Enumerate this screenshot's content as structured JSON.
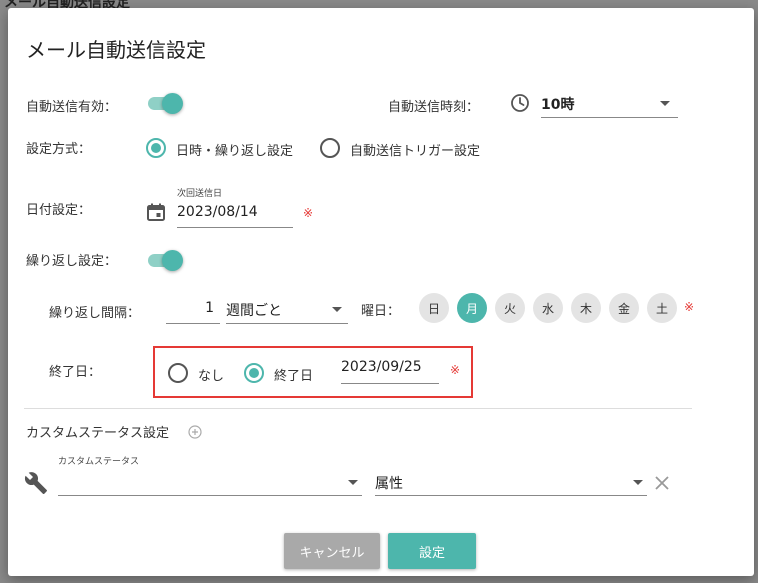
{
  "background_title": "メール自動送信設定",
  "dialog": {
    "title": "メール自動送信設定",
    "auto_send_enabled_label": "自動送信有効：",
    "auto_send_time_label": "自動送信時刻：",
    "auto_send_time_value": "10時",
    "setting_method_label": "設定方式：",
    "method_options": [
      "日時・繰り返し設定",
      "自動送信トリガー設定"
    ],
    "date_setting_label": "日付設定：",
    "next_send_date_label": "次回送信日",
    "next_send_date_value": "2023/08/14",
    "required_mark": "※",
    "repeat_setting_label": "繰り返し設定：",
    "repeat_interval_label": "繰り返し間隔：",
    "repeat_interval_value": "1",
    "repeat_unit_value": "週間ごと",
    "weekday_label": "曜日：",
    "weekdays": [
      "日",
      "月",
      "火",
      "水",
      "木",
      "金",
      "土"
    ],
    "end_date_label": "終了日：",
    "end_options": [
      "なし",
      "終了日"
    ],
    "end_date_value": "2023/09/25",
    "custom_status_section": "カスタムステータス設定",
    "custom_status_field_label": "カスタムステータス",
    "attribute_placeholder": "属性",
    "cancel_label": "キャンセル",
    "ok_label": "設定"
  },
  "colors": {
    "accent": "#4db6ac",
    "required": "#e53935"
  }
}
